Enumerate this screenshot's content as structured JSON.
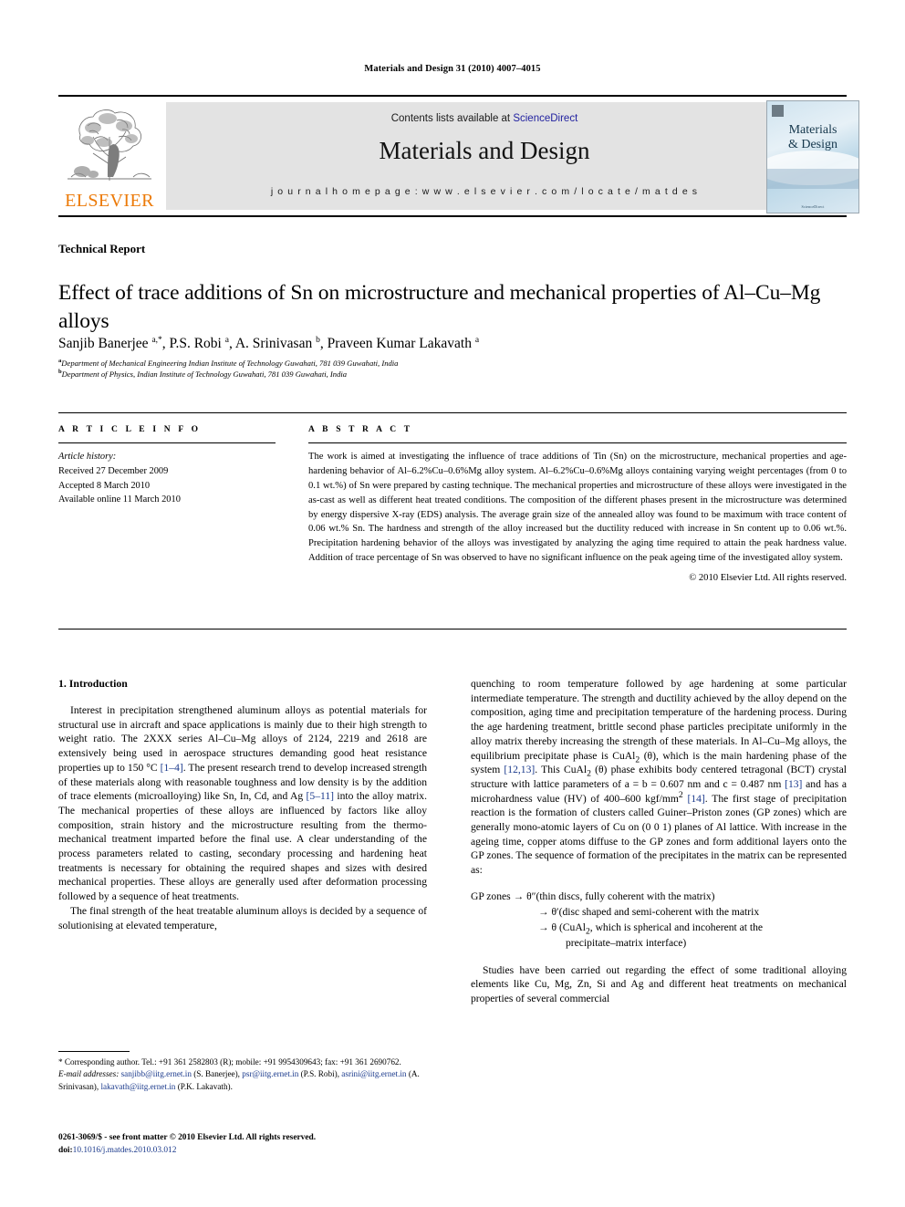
{
  "running_head": "Materials and Design 31 (2010) 4007–4015",
  "masthead": {
    "publisher_name": "ELSEVIER",
    "contents_prefix": "Contents lists available at ",
    "sciencedirect": "ScienceDirect",
    "journal_title": "Materials and Design",
    "homepage": "j o u r n a l   h o m e p a g e :   w w w . e l s e v i e r . c o m / l o c a t e / m a t d e s",
    "cover_title_line1": "Materials",
    "cover_title_line2": "& Design",
    "cover_footer": "ScienceDirect",
    "accent_color": "#ec7a08",
    "link_color": "#2222a0",
    "banner_bg": "#e3e3e3"
  },
  "article": {
    "doctype": "Technical Report",
    "title": "Effect of trace additions of Sn on microstructure and mechanical properties of Al–Cu–Mg alloys",
    "authors_html": "Sanjib Banerjee <sup>a,*</sup>, P.S. Robi <sup>a</sup>, A. Srinivasan <sup>b</sup>, Praveen Kumar Lakavath <sup>a</sup>",
    "affiliation_a": "Department of Mechanical Engineering Indian Institute of Technology Guwahati, 781 039 Guwahati, India",
    "affiliation_b": "Department of Physics, Indian Institute of Technology Guwahati, 781 039 Guwahati, India"
  },
  "article_info": {
    "heading": "A R T I C L E   I N F O",
    "history_label": "Article history:",
    "received": "Received 27 December 2009",
    "accepted": "Accepted 8 March 2010",
    "available": "Available online 11 March 2010"
  },
  "abstract": {
    "heading": "A B S T R A C T",
    "text": "The work is aimed at investigating the influence of trace additions of Tin (Sn) on the microstructure, mechanical properties and age-hardening behavior of Al–6.2%Cu–0.6%Mg alloy system. Al–6.2%Cu–0.6%Mg alloys containing varying weight percentages (from 0 to 0.1 wt.%) of Sn were prepared by casting technique. The mechanical properties and microstructure of these alloys were investigated in the as-cast as well as different heat treated conditions. The composition of the different phases present in the microstructure was determined by energy dispersive X-ray (EDS) analysis. The average grain size of the annealed alloy was found to be maximum with trace content of 0.06 wt.% Sn. The hardness and strength of the alloy increased but the ductility reduced with increase in Sn content up to 0.06 wt.%. Precipitation hardening behavior of the alloys was investigated by analyzing the aging time required to attain the peak hardness value. Addition of trace percentage of Sn was observed to have no significant influence on the peak ageing time of the investigated alloy system.",
    "copyright": "© 2010 Elsevier Ltd. All rights reserved."
  },
  "introduction": {
    "heading": "1. Introduction",
    "para1_a": "Interest in precipitation strengthened aluminum alloys as potential materials for structural use in aircraft and space applications is mainly due to their high strength to weight ratio. The 2XXX series Al–Cu–Mg alloys of 2124, 2219 and 2618 are extensively being used in aerospace structures demanding good heat resistance properties up to 150 °C ",
    "ref_1_4": "[1–4]",
    "para1_b": ". The present research trend to develop increased strength of these materials along with reasonable toughness and low density is by the addition of trace elements (microalloying) like Sn, In, Cd, and Ag ",
    "ref_5_11": "[5–11]",
    "para1_c": " into the alloy matrix. The mechanical properties of these alloys are influenced by factors like alloy composition, strain history and the microstructure resulting from the thermo-mechanical treatment imparted before the final use. A clear understanding of the process parameters related to casting, secondary processing and hardening heat treatments is necessary for obtaining the required shapes and sizes with desired mechanical properties. These alloys are generally used after deformation processing followed by a sequence of heat treatments.",
    "para2": "The final strength of the heat treatable aluminum alloys is decided by a sequence of solutionising at elevated temperature,",
    "para3_a": "quenching to room temperature followed by age hardening at some particular intermediate temperature. The strength and ductility achieved by the alloy depend on the composition, aging time and precipitation temperature of the hardening process. During the age hardening treatment, brittle second phase particles precipitate uniformly in the alloy matrix thereby increasing the strength of these materials. In Al–Cu–Mg alloys, the equilibrium precipitate phase is CuAl",
    "para3_sub2": "2",
    "para3_b": " (θ), which is the main hardening phase of the system ",
    "ref_12_13": "[12,13]",
    "para3_c": ". This CuAl",
    "para3_d": " (θ) phase exhibits body centered tetragonal (BCT) crystal structure with lattice parameters of a = b = 0.607 nm and c = 0.487 nm ",
    "ref_13": "[13]",
    "para3_e": " and has a microhardness value (HV) of 400–600 kgf/mm",
    "para3_sup2": "2",
    "para3_f": " ",
    "ref_14": "[14]",
    "para3_g": ". The first stage of precipitation reaction is the formation of clusters called Guiner–Priston zones (GP zones) which are generally mono-atomic layers of Cu on (0 0 1) planes of Al lattice. With increase in the ageing time, copper atoms diffuse to the GP zones and form additional layers onto the GP zones. The sequence of formation of the precipitates in the matrix can be represented as:",
    "sequence_line1": "GP zones → θ″(thin discs, fully coherent with the matrix)",
    "sequence_line2": "→ θ′(disc shaped and semi-coherent with the matrix",
    "sequence_line3_a": "→ θ (CuAl",
    "sequence_line3_sub": "2",
    "sequence_line3_b": ", which is spherical and incoherent at the",
    "sequence_line4": "precipitate–matrix interface)",
    "para4": "Studies have been carried out regarding the effect of some traditional alloying elements like Cu, Mg, Zn, Si and Ag and different heat treatments on mechanical properties of several commercial"
  },
  "footnotes": {
    "corresponding": "* Corresponding author. Tel.: +91 361 2582803 (R); mobile: +91 9954309643; fax: +91 361 2690762.",
    "email_label": "E-mail addresses:",
    "emails": [
      {
        "address": "sanjibb@iitg.ernet.in",
        "owner": " (S. Banerjee), "
      },
      {
        "address": "psr@iitg.ernet.in",
        "owner": " (P.S. Robi), "
      },
      {
        "address": "asrini@iitg.ernet.in",
        "owner": " (A. Srinivasan), "
      },
      {
        "address": "lakavath@iitg.ernet.in",
        "owner": " (P.K. Lakavath)."
      }
    ],
    "issn_line": "0261-3069/$ - see front matter © 2010 Elsevier Ltd. All rights reserved.",
    "doi_label": "doi:",
    "doi_value": "10.1016/j.matdes.2010.03.012"
  }
}
